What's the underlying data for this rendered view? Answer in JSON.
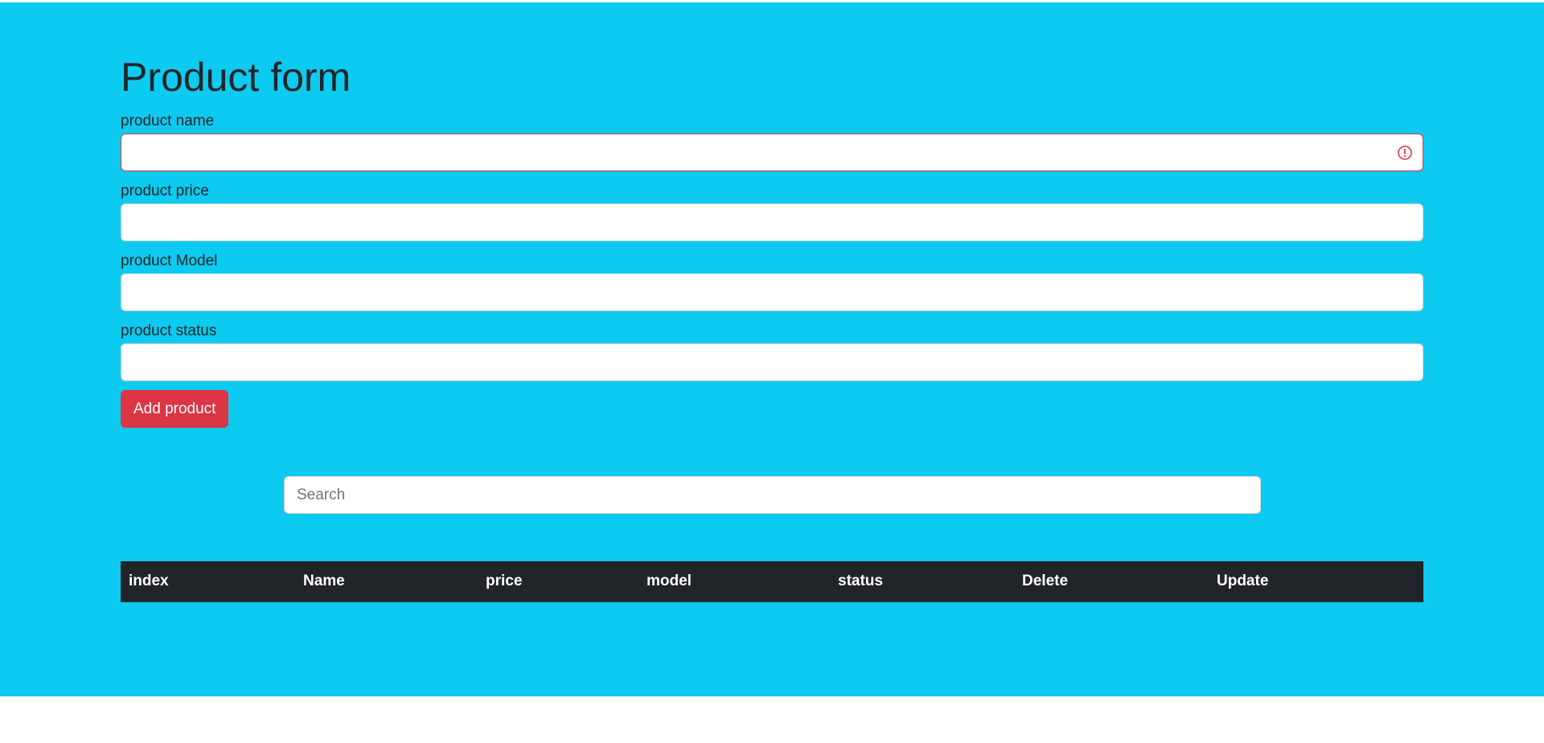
{
  "page": {
    "title": "Product form",
    "background_color": "#0dcaf0"
  },
  "form": {
    "fields": [
      {
        "label": "product name",
        "value": "",
        "state": "invalid"
      },
      {
        "label": "product price",
        "value": ""
      },
      {
        "label": "product Model",
        "value": ""
      },
      {
        "label": "product status",
        "value": ""
      }
    ],
    "invalid_icon": "exclamation-circle-icon",
    "submit_label": "Add product",
    "submit_color": "#dc3545"
  },
  "search": {
    "placeholder": "Search",
    "value": ""
  },
  "table": {
    "headers": [
      "index",
      "Name",
      "price",
      "model",
      "status",
      "Delete",
      "Update"
    ],
    "rows": [],
    "header_color": "#212529"
  }
}
